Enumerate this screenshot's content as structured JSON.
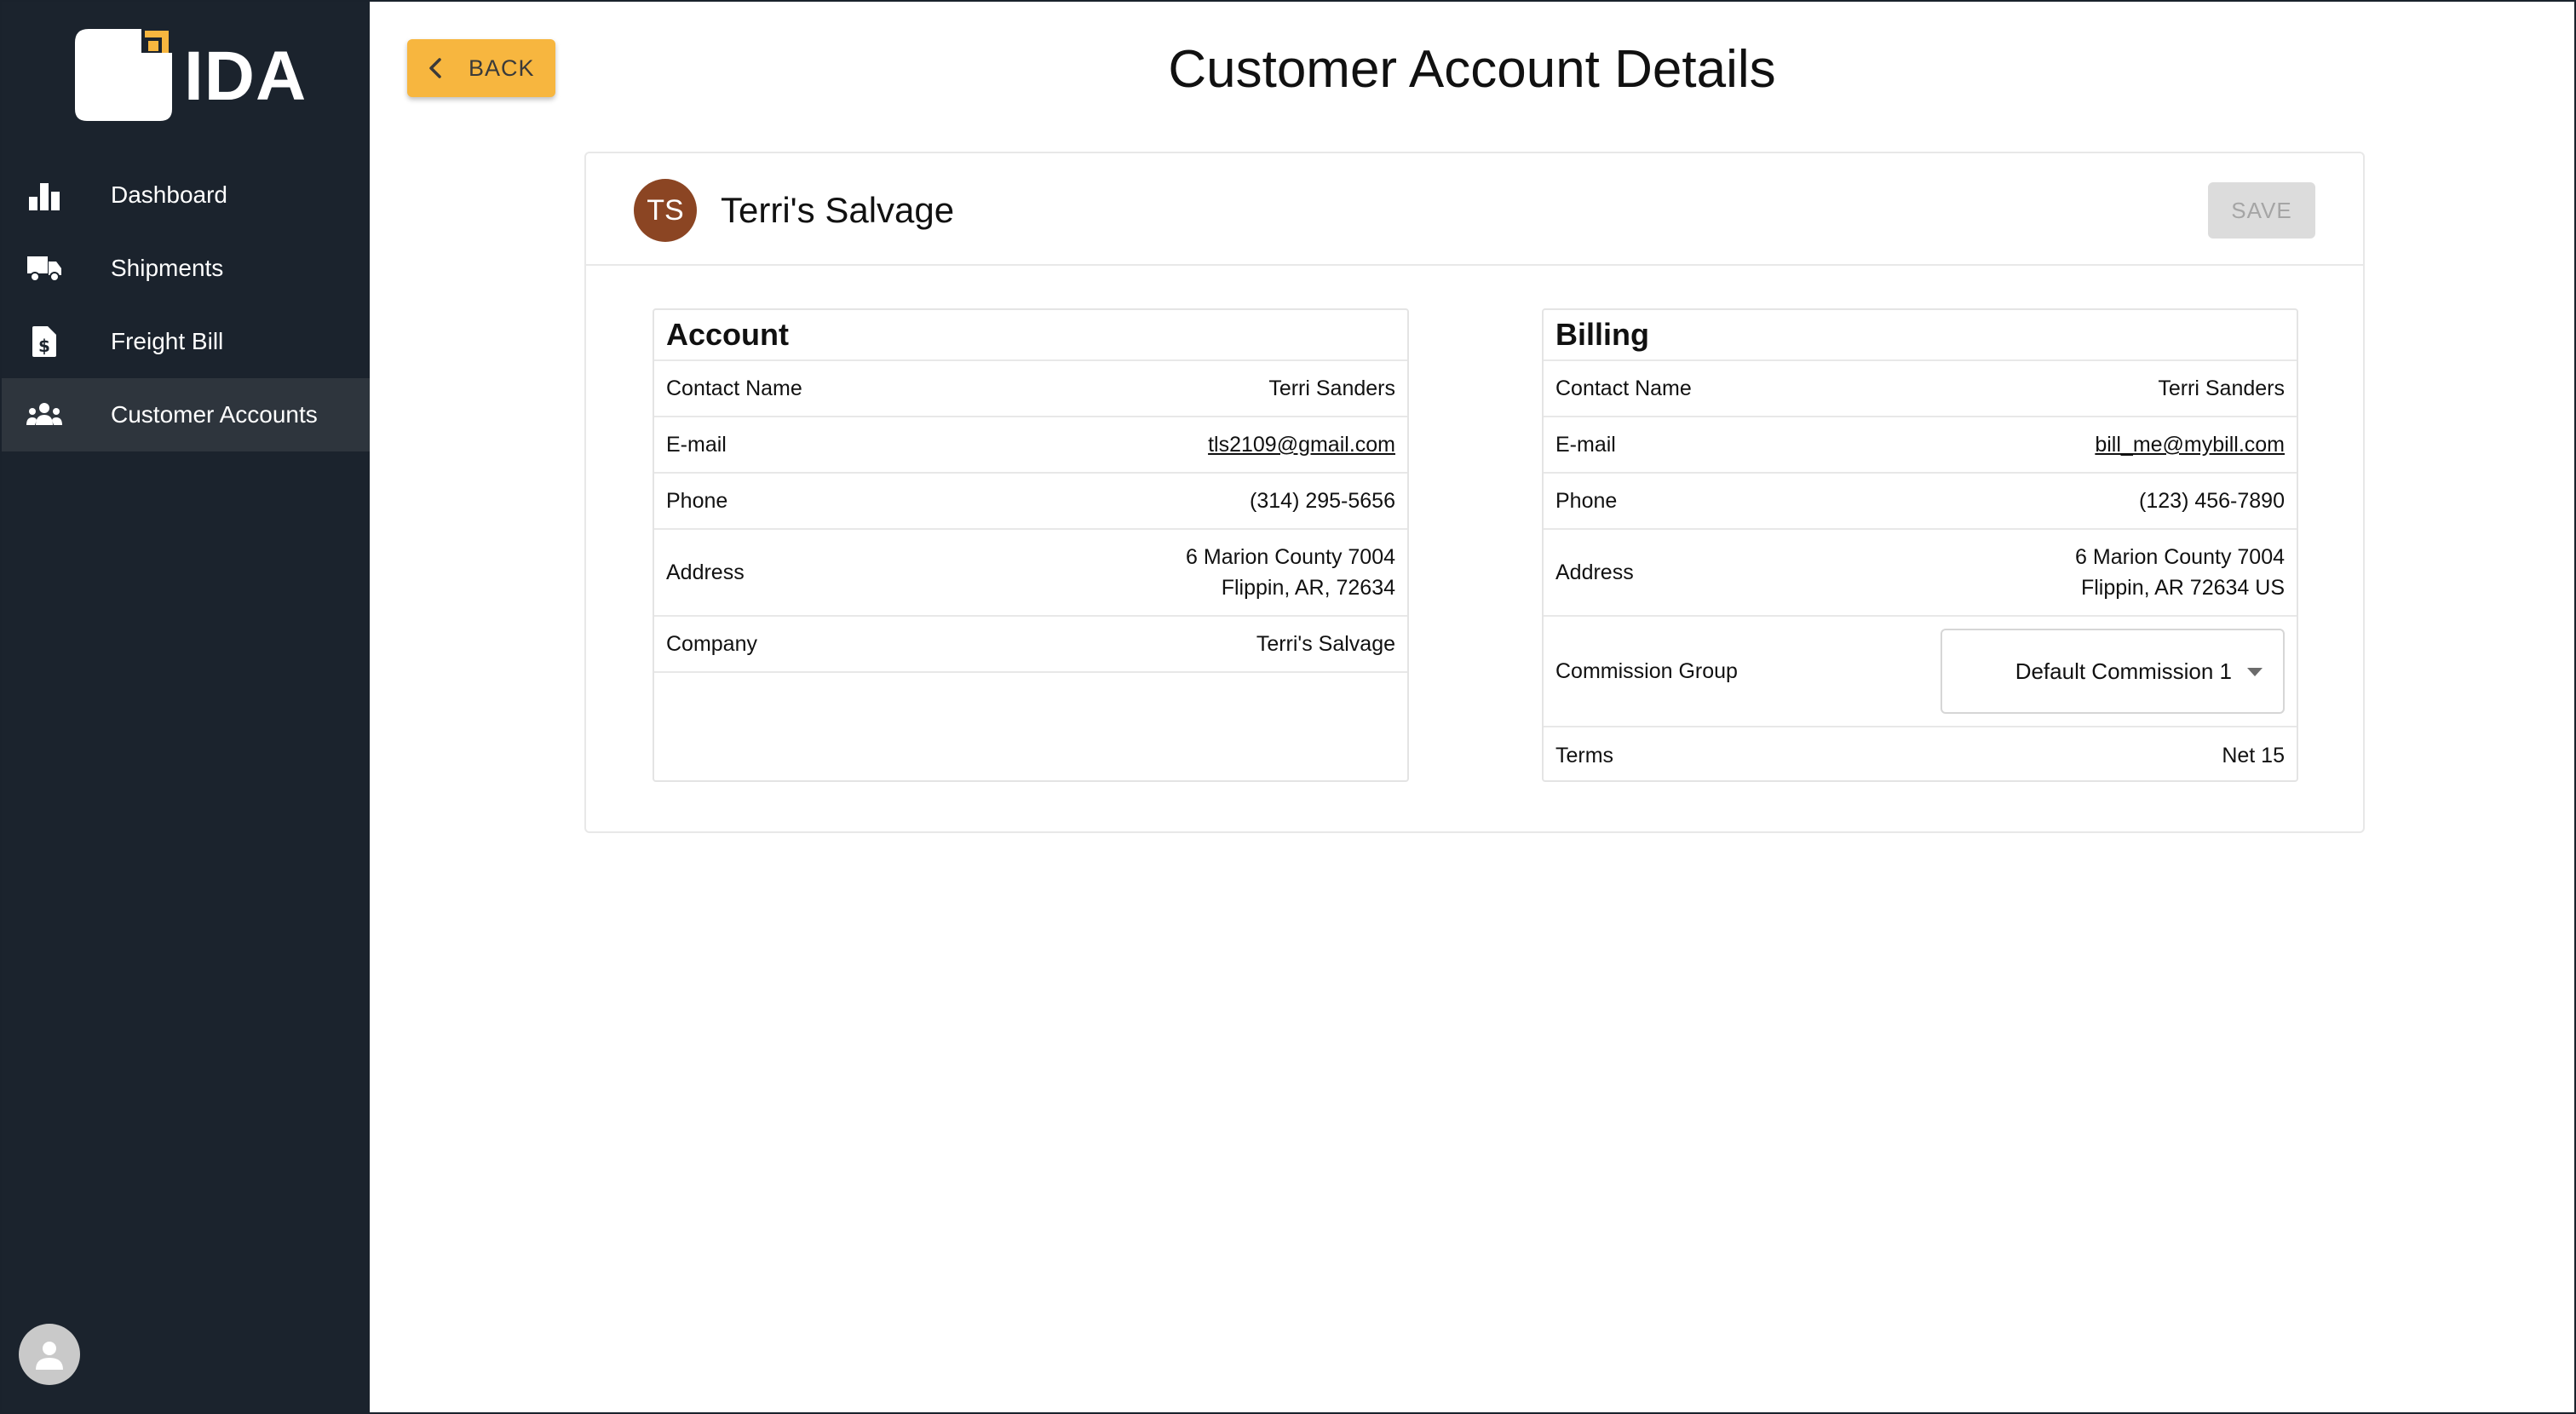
{
  "app": {
    "logo_text": "IDA",
    "brand_color": "#f7b63f"
  },
  "sidebar": {
    "items": [
      {
        "label": "Dashboard",
        "icon": "bar-chart-icon",
        "active": false
      },
      {
        "label": "Shipments",
        "icon": "truck-icon",
        "active": false
      },
      {
        "label": "Freight Bill",
        "icon": "invoice-dollar-icon",
        "active": false
      },
      {
        "label": "Customer Accounts",
        "icon": "people-group-icon",
        "active": true
      }
    ],
    "user_icon": "user-avatar-icon"
  },
  "header": {
    "back_label": "BACK",
    "title": "Customer Account Details"
  },
  "customer": {
    "initials": "TS",
    "name": "Terri's Salvage",
    "avatar_color": "#8b4523",
    "save_label": "SAVE"
  },
  "account": {
    "title": "Account",
    "contact_name_label": "Contact Name",
    "contact_name": "Terri Sanders",
    "email_label": "E-mail",
    "email": "tls2109@gmail.com",
    "phone_label": "Phone",
    "phone": "(314) 295-5656",
    "address_label": "Address",
    "address_line1": "6 Marion County 7004",
    "address_line2": "Flippin, AR, 72634",
    "company_label": "Company",
    "company": "Terri's Salvage"
  },
  "billing": {
    "title": "Billing",
    "contact_name_label": "Contact Name",
    "contact_name": "Terri Sanders",
    "email_label": "E-mail",
    "email": "bill_me@mybill.com",
    "phone_label": "Phone",
    "phone": "(123) 456-7890",
    "address_label": "Address",
    "address_line1": "6 Marion County 7004",
    "address_line2": "Flippin, AR 72634 US",
    "commission_label": "Commission Group",
    "commission_value": "Default Commission 1",
    "terms_label": "Terms",
    "terms": "Net 15"
  }
}
